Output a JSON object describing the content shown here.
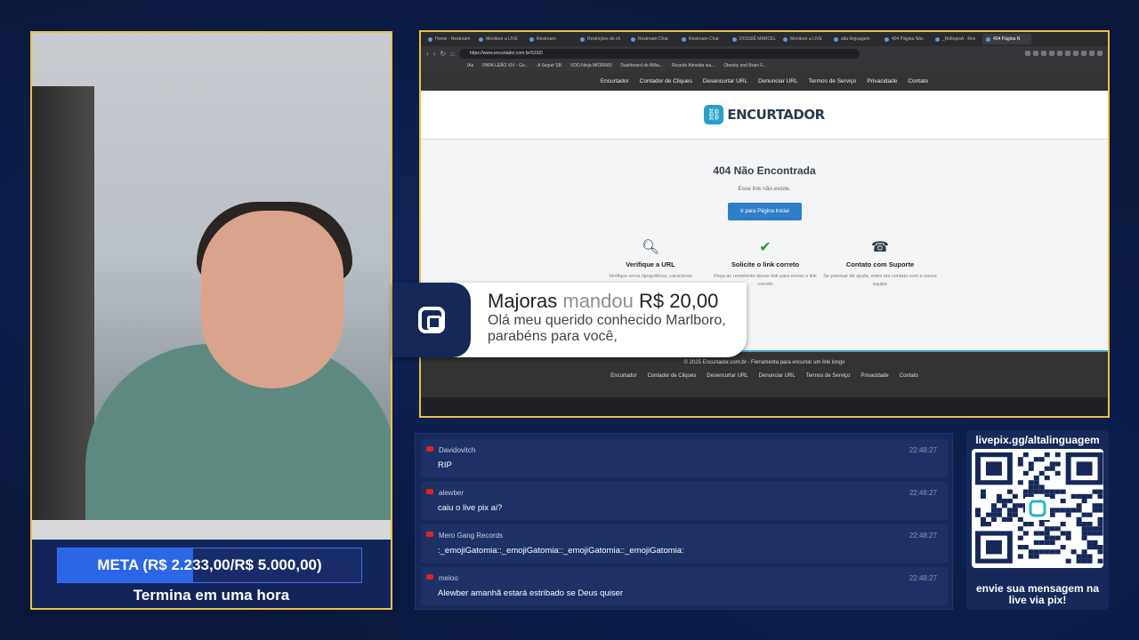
{
  "meta": {
    "label": "META (R$ 2.233,00/R$ 5.000,00)",
    "progress": 0.4466,
    "subtitle": "Termina em uma hora"
  },
  "browser": {
    "tabs": [
      "Home - Restream",
      "Monitore a LIVE",
      "Restream",
      "Restrições de ch",
      "Restream Chat",
      "Restream Chat",
      "DOSSIÊ MARCEL",
      "Monitore a LIVE",
      "alta linguagem",
      "404 Página Não",
      "_RoltopisA - Res",
      "404 Página N"
    ],
    "active_tab": 11,
    "url": "https://www.encurtador.com.br/S19Zl",
    "bookmarks": [
      "IAs",
      "PAPA LEÃO XIV - Go...",
      "A Seguir SB",
      "VDO.Ninja MIORIM3",
      "Dashboard de Afilia...",
      "Ricardo Almeida wa...",
      "Obesity and Brain F..."
    ]
  },
  "site": {
    "nav": [
      "Encurtador",
      "Contador de Cliques",
      "Desencurtar URL",
      "Denunciar URL",
      "Termos de Serviço",
      "Privacidade",
      "Contato"
    ],
    "logo_text": "ENCURTADOR",
    "title": "404 Não Encontrada",
    "message": "Esse link não existe.",
    "button": "Ir para Página Inicial",
    "cards": [
      {
        "title": "Verifique a URL",
        "desc": "Verifique erros tipográficos, caracteres",
        "icon": "magnifier-icon"
      },
      {
        "title": "Solicite o link correto",
        "desc": "Peça ao remetente desse link para enviar o link correto",
        "icon": "check-icon"
      },
      {
        "title": "Contato com Suporte",
        "desc": "Se precisar de ajuda, entre em contato com a nossa equipe",
        "icon": "support-icon"
      }
    ],
    "footer": "© 2025 Encurtador.com.br - Ferramenta para encurtar um link longo",
    "footer_links": [
      "Encurtador",
      "Contador de Cliques",
      "Desencurtar URL",
      "Denunciar URL",
      "Termos de Serviço",
      "Privacidade",
      "Contato"
    ]
  },
  "alert": {
    "name": "Majoras",
    "verb": "mandou",
    "amount": "R$ 20,00",
    "message": "Olá meu querido conhecido Marlboro, parabéns para você,"
  },
  "chat": [
    {
      "user": "Davidovitch",
      "time": "22:48:27",
      "text": "RIP"
    },
    {
      "user": "alewber",
      "time": "22:48:27",
      "text": "caiu o live pix ai?"
    },
    {
      "user": "Mero Gang Records",
      "time": "22:48:27",
      "text": ":_emojiGatomia::_emojiGatomia::_emojiGatomia::_emojiGatomia:"
    },
    {
      "user": "meloo",
      "time": "22:48:27",
      "text": "Alewber amanhã estará estribado se Deus quiser"
    }
  ],
  "qr": {
    "url": "livepix.gg/altalinguagem",
    "caption_line1": "envie sua mensagem na",
    "caption_line2": "live via pix!"
  },
  "colors": {
    "frame": "#e8c14a",
    "meta_fill": "#2a66e6",
    "panel": "#17295b",
    "site_accent": "#27a0c9"
  }
}
